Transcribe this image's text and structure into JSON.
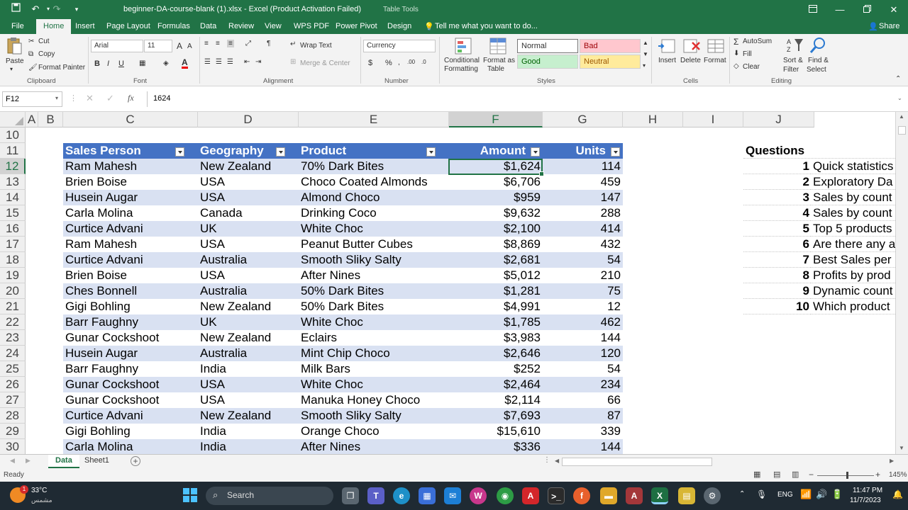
{
  "title_bar": {
    "document_title": "beginner-DA-course-blank (1).xlsx - Excel (Product Activation Failed)",
    "contextual_tab_group": "Table Tools"
  },
  "menu": {
    "tabs": [
      "File",
      "Home",
      "Insert",
      "Page Layout",
      "Formulas",
      "Data",
      "Review",
      "View",
      "WPS PDF",
      "Power Pivot",
      "Design"
    ],
    "active": "Home",
    "tell_me": "Tell me what you want to do...",
    "share": "Share"
  },
  "ribbon": {
    "clipboard": {
      "paste": "Paste",
      "cut": "Cut",
      "copy": "Copy",
      "format_painter": "Format Painter",
      "label": "Clipboard"
    },
    "font": {
      "name": "Arial",
      "size": "11",
      "bold": "B",
      "italic": "I",
      "underline": "U",
      "label": "Font"
    },
    "alignment": {
      "wrap_text": "Wrap Text",
      "merge_center": "Merge & Center",
      "label": "Alignment"
    },
    "number": {
      "format": "Currency",
      "dollar": "$",
      "percent": "%",
      "label": "Number"
    },
    "styles": {
      "conditional_formatting_line1": "Conditional",
      "conditional_formatting_line2": "Formatting",
      "format_as_table_line1": "Format as",
      "format_as_table_line2": "Table",
      "normal": "Normal",
      "bad": "Bad",
      "good": "Good",
      "neutral": "Neutral",
      "label": "Styles"
    },
    "cells": {
      "insert": "Insert",
      "delete": "Delete",
      "format": "Format",
      "label": "Cells"
    },
    "editing": {
      "autosum": "AutoSum",
      "fill": "Fill",
      "clear": "Clear",
      "sort_line1": "Sort &",
      "sort_line2": "Filter",
      "find_line1": "Find &",
      "find_line2": "Select",
      "label": "Editing"
    }
  },
  "formula_bar": {
    "name_box": "F12",
    "fx": "fx",
    "value": "1624"
  },
  "columns": [
    "A",
    "B",
    "C",
    "D",
    "E",
    "F",
    "G",
    "H",
    "I",
    "J"
  ],
  "rows": [
    "10",
    "11",
    "12",
    "13",
    "14",
    "15",
    "16",
    "17",
    "18",
    "19",
    "20",
    "21",
    "22",
    "23",
    "24",
    "25",
    "26",
    "27",
    "28",
    "29",
    "30"
  ],
  "table": {
    "headers": [
      "Sales Person",
      "Geography",
      "Product",
      "Amount",
      "Units"
    ],
    "rows": [
      [
        "Ram Mahesh",
        "New Zealand",
        "70% Dark Bites",
        "$1,624",
        "114"
      ],
      [
        "Brien Boise",
        "USA",
        "Choco Coated Almonds",
        "$6,706",
        "459"
      ],
      [
        "Husein Augar",
        "USA",
        "Almond Choco",
        "$959",
        "147"
      ],
      [
        "Carla Molina",
        "Canada",
        "Drinking Coco",
        "$9,632",
        "288"
      ],
      [
        "Curtice Advani",
        "UK",
        "White Choc",
        "$2,100",
        "414"
      ],
      [
        "Ram Mahesh",
        "USA",
        "Peanut Butter Cubes",
        "$8,869",
        "432"
      ],
      [
        "Curtice Advani",
        "Australia",
        "Smooth Sliky Salty",
        "$2,681",
        "54"
      ],
      [
        "Brien Boise",
        "USA",
        "After Nines",
        "$5,012",
        "210"
      ],
      [
        "Ches Bonnell",
        "Australia",
        "50% Dark Bites",
        "$1,281",
        "75"
      ],
      [
        "Gigi Bohling",
        "New Zealand",
        "50% Dark Bites",
        "$4,991",
        "12"
      ],
      [
        "Barr Faughny",
        "UK",
        "White Choc",
        "$1,785",
        "462"
      ],
      [
        "Gunar Cockshoot",
        "New Zealand",
        "Eclairs",
        "$3,983",
        "144"
      ],
      [
        "Husein Augar",
        "Australia",
        "Mint Chip Choco",
        "$2,646",
        "120"
      ],
      [
        "Barr Faughny",
        "India",
        "Milk Bars",
        "$252",
        "54"
      ],
      [
        "Gunar Cockshoot",
        "USA",
        "White Choc",
        "$2,464",
        "234"
      ],
      [
        "Gunar Cockshoot",
        "USA",
        "Manuka Honey Choco",
        "$2,114",
        "66"
      ],
      [
        "Curtice Advani",
        "New Zealand",
        "Smooth Sliky Salty",
        "$7,693",
        "87"
      ],
      [
        "Gigi Bohling",
        "India",
        "Orange Choco",
        "$15,610",
        "339"
      ],
      [
        "Carla Molina",
        "India",
        "After Nines",
        "$336",
        "144"
      ]
    ]
  },
  "questions": {
    "heading": "Questions",
    "items": [
      {
        "n": "1",
        "text": "Quick statistics"
      },
      {
        "n": "2",
        "text": "Exploratory Da"
      },
      {
        "n": "3",
        "text": "Sales by count"
      },
      {
        "n": "4",
        "text": "Sales by count"
      },
      {
        "n": "5",
        "text": "Top 5 products"
      },
      {
        "n": "6",
        "text": "Are there any a"
      },
      {
        "n": "7",
        "text": "Best Sales per"
      },
      {
        "n": "8",
        "text": "Profits by prod"
      },
      {
        "n": "9",
        "text": "Dynamic count"
      },
      {
        "n": "10",
        "text": "Which product"
      }
    ]
  },
  "sheets": {
    "tabs": [
      "Data",
      "Sheet1"
    ],
    "active": "Data"
  },
  "status": {
    "ready": "Ready",
    "zoom": "145%"
  },
  "taskbar": {
    "weather_temp": "33°C",
    "weather_desc": "مشمس",
    "search": "Search",
    "lang": "ENG",
    "time": "11:47 PM",
    "date": "11/7/2023",
    "badge": "1"
  },
  "colors": {
    "excel_green": "#217346",
    "table_header": "#4472c4",
    "table_band": "#d9e1f2"
  }
}
